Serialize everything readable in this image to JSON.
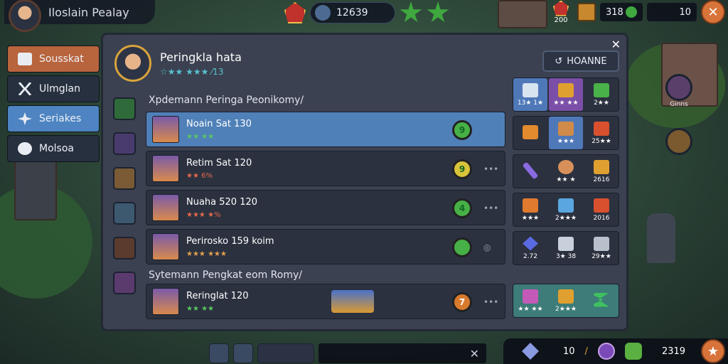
{
  "player": {
    "name": "Iloslain Pealay"
  },
  "top": {
    "currency": "12639",
    "res1": "200",
    "res2": "318",
    "res3": "10"
  },
  "nav": [
    {
      "label": "Sousskat"
    },
    {
      "label": "Ulmglan"
    },
    {
      "label": "Seriakes"
    },
    {
      "label": "Molsoa"
    }
  ],
  "panel": {
    "hero_name": "Peringkla hata",
    "hero_sub": "☆★★ ★★★ ⁄13",
    "home_label": "HOANNE",
    "section1": "Xpdemann Peringa Peonikomy/",
    "section2": "Sytemann Pengkat eom Romy/",
    "rows": [
      {
        "name": "Noain Sat 130",
        "sub": "★★ ★★",
        "orb": "9",
        "sub_color": "#59c760"
      },
      {
        "name": "Retim Sat 120",
        "sub": "★★ 6%",
        "orb": "9",
        "sub_color": "#e56a4c"
      },
      {
        "name": "Nuaha 520 120",
        "sub": "★★★ ★%",
        "orb": "4",
        "sub_color": "#e56a4c"
      },
      {
        "name": "Perirosko 159 koim",
        "sub": "★★★ ★★★",
        "orb": "",
        "sub_color": "#e5a04c"
      },
      {
        "name": "Reringlat 120",
        "sub": "★★ ★★",
        "orb": "7",
        "sub_color": "#59c760"
      }
    ],
    "grid": [
      [
        "13★ 1★",
        "★★ ★★",
        "2★★"
      ],
      [
        "",
        "★★★",
        "25★★"
      ],
      [
        "",
        "★★ ★",
        "2616"
      ],
      [
        "★★★",
        "2★★★",
        "2016"
      ],
      [
        "2.72",
        "3★ 38",
        "29★★"
      ],
      [
        "★★ ★★",
        "2★★★",
        ""
      ]
    ]
  },
  "right_label": "Ginns",
  "bottom": {
    "count": "10",
    "score": "2319"
  },
  "colors": {
    "accent": "#5080b8",
    "orange": "#b8643c"
  }
}
